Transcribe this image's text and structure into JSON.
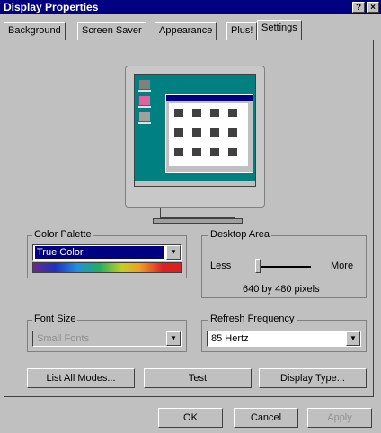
{
  "window": {
    "title": "Display Properties",
    "help_button": "?",
    "close_button": "×"
  },
  "tabs": [
    {
      "label": "Background"
    },
    {
      "label": "Screen Saver"
    },
    {
      "label": "Appearance"
    },
    {
      "label": "Plus!"
    },
    {
      "label": "Settings"
    }
  ],
  "active_tab": "Settings",
  "color_palette": {
    "label": "Color Palette",
    "value": "True Color"
  },
  "desktop_area": {
    "label": "Desktop Area",
    "less": "Less",
    "more": "More",
    "resolution": "640 by 480 pixels",
    "slider_level": 0
  },
  "font_size": {
    "label": "Font Size",
    "value": "Small Fonts"
  },
  "refresh_frequency": {
    "label": "Refresh Frequency",
    "value": "85 Hertz"
  },
  "buttons": {
    "list_all_modes": "List All Modes...",
    "test": "Test",
    "display_type": "Display Type..."
  },
  "footer": {
    "ok": "OK",
    "cancel": "Cancel",
    "apply": "Apply"
  }
}
